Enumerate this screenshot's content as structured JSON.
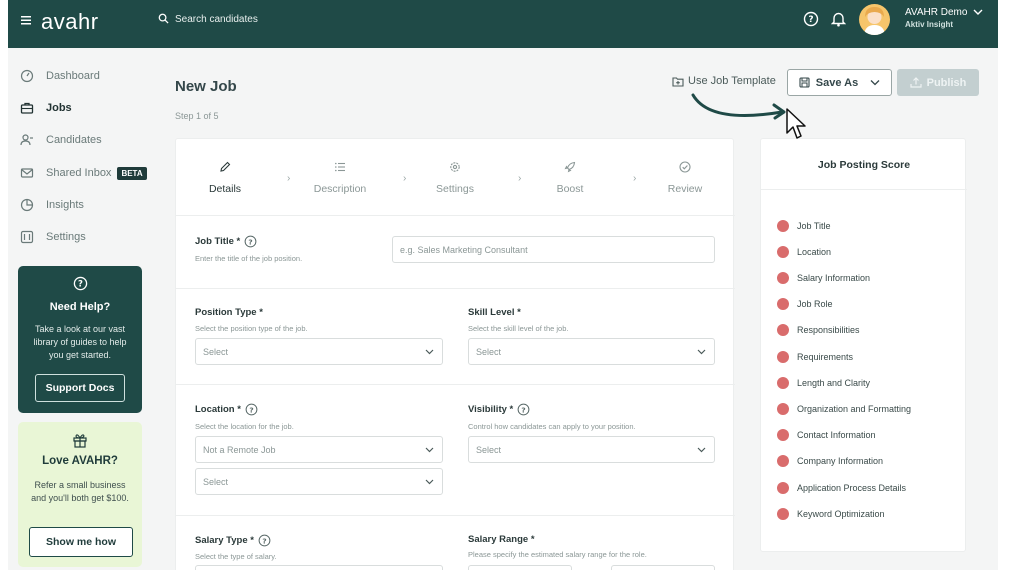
{
  "app": {
    "logo": "avahr",
    "search_placeholder": "Search candidates",
    "user_name": "AVAHR Demo",
    "user_org": "Aktiv Insight"
  },
  "sidebar": {
    "items": [
      {
        "label": "Dashboard",
        "icon": "dashboard-icon"
      },
      {
        "label": "Jobs",
        "icon": "briefcase-icon"
      },
      {
        "label": "Candidates",
        "icon": "candidates-icon"
      },
      {
        "label": "Shared Inbox",
        "icon": "mail-icon",
        "badge": "BETA"
      },
      {
        "label": "Insights",
        "icon": "chart-icon"
      },
      {
        "label": "Settings",
        "icon": "settings-icon"
      }
    ],
    "help": {
      "title": "Need Help?",
      "body": "Take a look at our vast library of guides to help you get started.",
      "button": "Support Docs"
    },
    "love": {
      "title": "Love AVAHR?",
      "body": "Refer a small business and you'll both get $100.",
      "button": "Show me how"
    }
  },
  "header": {
    "title": "New Job",
    "step": "Step 1 of 5",
    "template_link": "Use Job Template",
    "save_as": "Save As",
    "publish": "Publish"
  },
  "steps": [
    {
      "label": "Details",
      "icon": "pencil-icon"
    },
    {
      "label": "Description",
      "icon": "list-icon"
    },
    {
      "label": "Settings",
      "icon": "gear-icon"
    },
    {
      "label": "Boost",
      "icon": "rocket-icon"
    },
    {
      "label": "Review",
      "icon": "check-circle-icon"
    }
  ],
  "form": {
    "job_title": {
      "label": "Job Title *",
      "help": "Enter the title of the job position.",
      "placeholder": "e.g. Sales Marketing Consultant"
    },
    "position_type": {
      "label": "Position Type *",
      "help": "Select the position type of the job.",
      "value": "Select"
    },
    "skill_level": {
      "label": "Skill Level *",
      "help": "Select the skill level of the job.",
      "value": "Select"
    },
    "location": {
      "label": "Location *",
      "help": "Select the location for the job.",
      "value": "Not a Remote Job",
      "value2": "Select"
    },
    "visibility": {
      "label": "Visibility *",
      "help": "Control how candidates can apply to your position.",
      "value": "Select"
    },
    "salary_type": {
      "label": "Salary Type *",
      "help": "Select the type of salary."
    },
    "salary_range": {
      "label": "Salary Range *",
      "help": "Please specify the estimated salary range for the role."
    }
  },
  "score": {
    "title": "Job Posting Score",
    "items": [
      "Job Title",
      "Location",
      "Salary Information",
      "Job Role",
      "Responsibilities",
      "Requirements",
      "Length and Clarity",
      "Organization and Formatting",
      "Contact Information",
      "Company Information",
      "Application Process Details",
      "Keyword Optimization"
    ],
    "dot_color": "#d96c6c"
  },
  "colors": {
    "brand": "#1f4a47",
    "accent_light": "#e9f6d6"
  }
}
